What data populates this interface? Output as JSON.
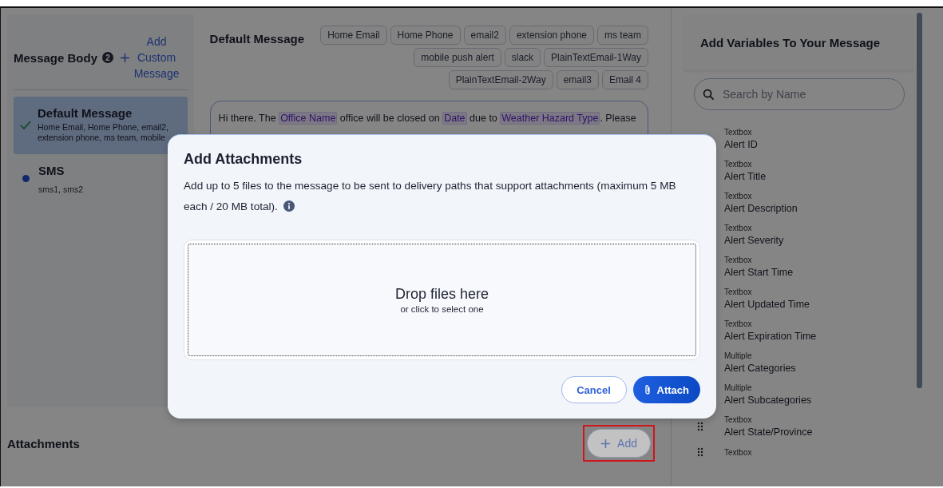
{
  "message_body": {
    "title": "Message Body",
    "count": "2",
    "add_link": "Add Custom Message",
    "items": [
      {
        "name": "Default Message",
        "paths": "Home Email, Home Phone, email2, extension phone, ms team, mobile",
        "selected": true
      },
      {
        "name": "SMS",
        "paths": "sms1, sms2",
        "selected": false
      }
    ]
  },
  "editor": {
    "title": "Default Message",
    "chips": [
      "Home Email",
      "Home Phone",
      "email2",
      "extension phone",
      "ms team",
      "mobile push alert",
      "slack",
      "PlainTextEmail-1Way",
      "PlainTextEmail-2Way",
      "email3",
      "Email 4"
    ],
    "message": [
      {
        "kind": "text",
        "text": "Hi there. The "
      },
      {
        "kind": "var",
        "text": "Office Name"
      },
      {
        "kind": "text",
        "text": " office will be closed on "
      },
      {
        "kind": "var",
        "text": "Date"
      },
      {
        "kind": "text",
        "text": " due to "
      },
      {
        "kind": "var",
        "text": "Weather Hazard Type"
      },
      {
        "kind": "text",
        "text": ". Please"
      }
    ]
  },
  "attachments": {
    "title": "Attachments",
    "add_button": "Add"
  },
  "variables": {
    "title": "Add Variables To Your Message",
    "search": {
      "placeholder": "Search by Name"
    },
    "items": [
      {
        "type": "Textbox",
        "name": "Alert ID"
      },
      {
        "type": "Textbox",
        "name": "Alert Title"
      },
      {
        "type": "Textbox",
        "name": "Alert Description"
      },
      {
        "type": "Textbox",
        "name": "Alert Severity"
      },
      {
        "type": "Textbox",
        "name": "Alert Start Time"
      },
      {
        "type": "Textbox",
        "name": "Alert Updated Time"
      },
      {
        "type": "Textbox",
        "name": "Alert Expiration Time"
      },
      {
        "type": "Multiple",
        "name": "Alert Categories"
      },
      {
        "type": "Multiple",
        "name": "Alert Subcategories"
      },
      {
        "type": "Textbox",
        "name": "Alert State/Province"
      },
      {
        "type": "Textbox"
      }
    ]
  },
  "dialog": {
    "title": "Add Attachments",
    "description": "Add up to 5 files to the message to be sent to delivery paths that support attachments (maximum 5 MB each / 20 MB total).",
    "dropzone": {
      "title": "Drop files here",
      "hint": "or click to select one"
    },
    "buttons": [
      {
        "kind": "secondary",
        "label": "Cancel"
      },
      {
        "kind": "primary",
        "label": "Attach"
      }
    ]
  }
}
